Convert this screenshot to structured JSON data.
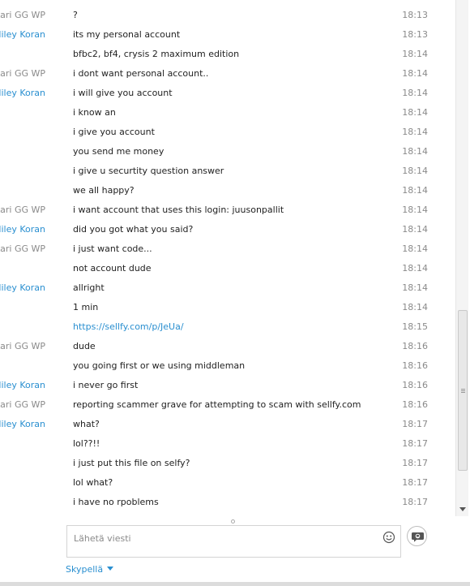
{
  "conversation": {
    "messages": [
      {
        "sender": "Lari GG WP",
        "text": "?",
        "time": "18:13"
      },
      {
        "sender": "Miley Koran",
        "text": "its my personal account",
        "time": "18:13"
      },
      {
        "sender": "",
        "text": "bfbc2, bf4, crysis 2 maximum edition",
        "time": "18:14"
      },
      {
        "sender": "Lari GG WP",
        "text": "i dont want personal account..",
        "time": "18:14"
      },
      {
        "sender": "Miley Koran",
        "text": "i will give you account",
        "time": "18:14"
      },
      {
        "sender": "",
        "text": "i know an",
        "time": "18:14"
      },
      {
        "sender": "",
        "text": "i give you account",
        "time": "18:14"
      },
      {
        "sender": "",
        "text": "you send me money",
        "time": "18:14"
      },
      {
        "sender": "",
        "text": "i give u securtity question answer",
        "time": "18:14"
      },
      {
        "sender": "",
        "text": "we all happy?",
        "time": "18:14"
      },
      {
        "sender": "Lari GG WP",
        "text": "i want account that uses this login: juusonpallit",
        "time": "18:14"
      },
      {
        "sender": "Miley Koran",
        "text": "did you got what you said?",
        "time": "18:14"
      },
      {
        "sender": "Lari GG WP",
        "text": "i just want code...",
        "time": "18:14"
      },
      {
        "sender": "",
        "text": "not account dude",
        "time": "18:14"
      },
      {
        "sender": "Miley Koran",
        "text": "allright",
        "time": "18:14"
      },
      {
        "sender": "",
        "text": "1 min",
        "time": "18:14"
      },
      {
        "sender": "",
        "text": "https://sellfy.com/p/JeUa/",
        "time": "18:15",
        "link": true
      },
      {
        "sender": "Lari GG WP",
        "text": "dude",
        "time": "18:16"
      },
      {
        "sender": "",
        "text": "you going first or we using middleman",
        "time": "18:16"
      },
      {
        "sender": "Miley Koran",
        "text": "i never go first",
        "time": "18:16"
      },
      {
        "sender": "Lari GG WP",
        "text": "reporting scammer grave for attempting to scam with sellfy.com",
        "time": "18:16"
      },
      {
        "sender": "Miley Koran",
        "text": "what?",
        "time": "18:17"
      },
      {
        "sender": "",
        "text": "lol??!!",
        "time": "18:17"
      },
      {
        "sender": "",
        "text": "i just put this file on selfy?",
        "time": "18:17"
      },
      {
        "sender": "",
        "text": "lol what?",
        "time": "18:17"
      },
      {
        "sender": "",
        "text": "i have no rpoblems",
        "time": "18:17"
      }
    ]
  },
  "composer": {
    "placeholder": "Lähetä viesti",
    "emoji_icon": "smiley-icon",
    "send_icon": "send-message-icon"
  },
  "footer": {
    "service_label": "Skypellä"
  },
  "colors": {
    "self_sender": "#8a8a8a",
    "other_sender": "#2a8fd0",
    "link": "#2a8fd0",
    "timestamp": "#8a8a8a"
  },
  "scroll_position": 0.97
}
